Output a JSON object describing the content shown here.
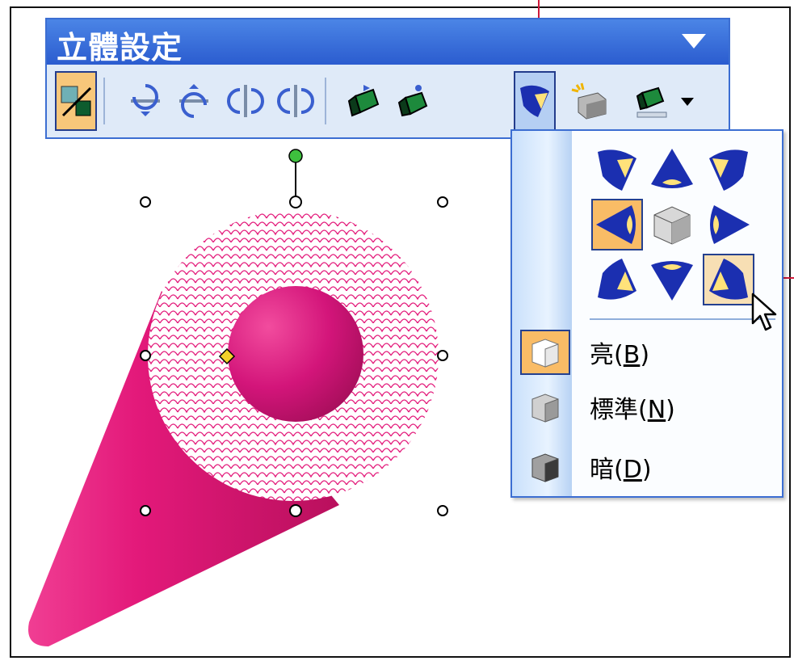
{
  "colors": {
    "titlebar": "#2b5ccf",
    "toolbar_bg": "#dfeaf8",
    "selected": "#f9bc66",
    "shape": "#e3197a",
    "callout": "#d0193a",
    "light_blue": "#1b2fb0",
    "handle_rotate": "#3ec03e",
    "handle_adjust": "#f3d02a"
  },
  "toolbar": {
    "title": "立體設定",
    "menu_icon": "dropdown-triangle-icon",
    "close_label": "×",
    "buttons": [
      {
        "name": "toggle-3d-button",
        "icon": "3d-toggle-icon",
        "state": "active"
      },
      {
        "name": "tilt-down-button",
        "icon": "tilt-down-icon"
      },
      {
        "name": "tilt-up-button",
        "icon": "tilt-up-icon"
      },
      {
        "name": "tilt-left-button",
        "icon": "tilt-left-icon"
      },
      {
        "name": "tilt-right-button",
        "icon": "tilt-right-icon"
      },
      {
        "name": "depth-button",
        "icon": "depth-icon"
      },
      {
        "name": "direction-button",
        "icon": "direction-icon"
      },
      {
        "name": "lighting-button",
        "icon": "lighting-icon",
        "state": "pressed"
      },
      {
        "name": "surface-button",
        "icon": "surface-icon"
      },
      {
        "name": "3d-color-button",
        "icon": "3d-color-icon"
      }
    ]
  },
  "lighting_menu": {
    "directions": [
      "top-left",
      "top",
      "top-right",
      "left",
      "center",
      "right",
      "bottom-left",
      "bottom",
      "bottom-right"
    ],
    "selected_direction": "left",
    "hovered_direction": "bottom-right",
    "intensity_items": [
      {
        "label": "亮",
        "accel": "B",
        "selected": true,
        "icon": "bright-cube-icon"
      },
      {
        "label": "標準",
        "accel": "N",
        "selected": false,
        "icon": "normal-cube-icon"
      },
      {
        "label": "暗",
        "accel": "D",
        "selected": false,
        "icon": "dim-cube-icon"
      }
    ]
  }
}
